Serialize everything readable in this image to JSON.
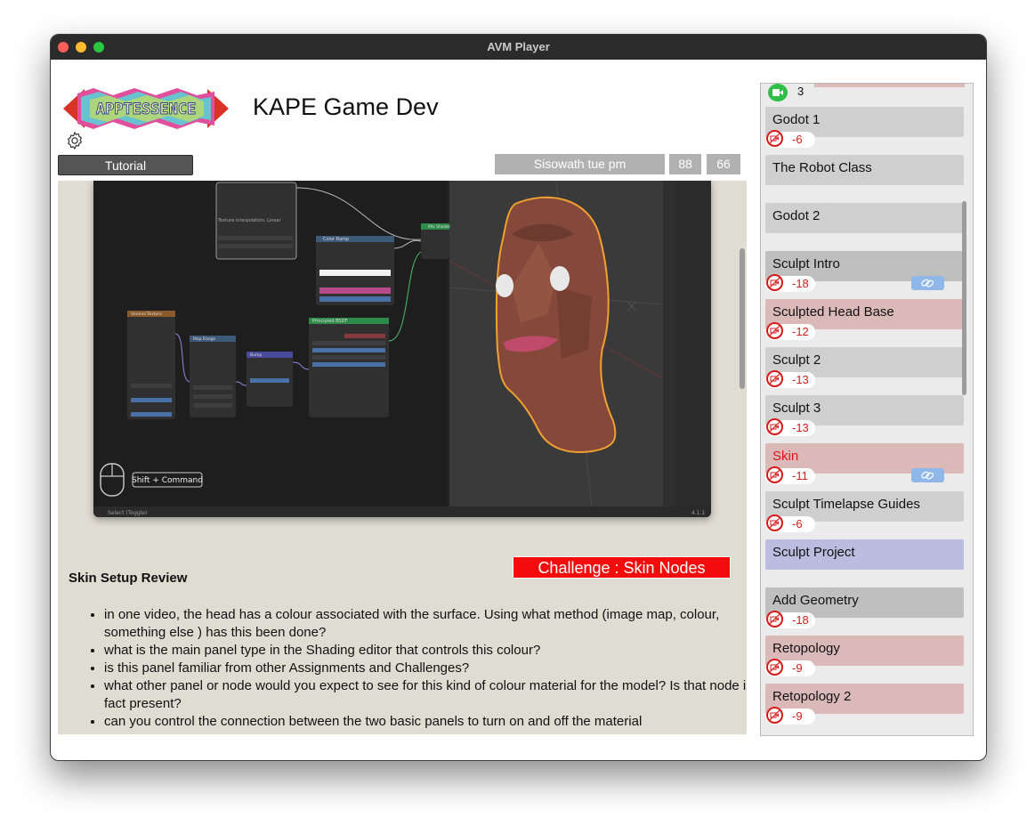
{
  "window": {
    "title": "AVM Player"
  },
  "header": {
    "app_title": "KAPE Game Dev",
    "logo_text": "APPTESSENCE",
    "tutorial_label": "Tutorial",
    "group_label": "Sisowath tue pm",
    "count_a": "88",
    "count_b": "66"
  },
  "video": {
    "shortcut_label": "Shift + Command",
    "status_text": "Select (Toggle)",
    "version": "4.1.1",
    "nodes": {
      "texture": "Texture interpolation: Linear",
      "color_ramp": "Color Ramp",
      "principled": "Principled BSDF",
      "voronoi": "Voronoi Texture",
      "map_range": "Map Range",
      "bump": "Bump",
      "mix_shader": "Mix Shader"
    }
  },
  "challenge": {
    "label": "Challenge : Skin Nodes"
  },
  "section": {
    "title": "Skin Setup Review",
    "questions": [
      "in one video, the head has a colour associated with the surface. Using what method (image map, colour, something else ) has this been done?",
      "what is the main panel type in the Shading editor that controls this colour?",
      "is this panel familiar from other Assignments and Challenges?",
      "what other panel or node would you expect to see for this kind of colour material for the model? Is that node in fact present?",
      "can you control the connection between the two basic panels to turn on and off the material"
    ]
  },
  "sidebar": {
    "top_count": "3",
    "items": [
      {
        "label": "Godot 1",
        "count": "-6"
      },
      {
        "label": "The Robot Class"
      },
      {
        "label": "Godot 2"
      },
      {
        "label": "Sculpt Intro",
        "count": "-18"
      },
      {
        "label": "Sculpted Head Base",
        "count": "-12"
      },
      {
        "label": "Sculpt 2",
        "count": "-13"
      },
      {
        "label": "Sculpt 3",
        "count": "-13"
      },
      {
        "label": "Skin",
        "count": "-11"
      },
      {
        "label": "Sculpt Timelapse Guides",
        "count": "-6"
      },
      {
        "label": "Sculpt Project"
      },
      {
        "label": "Add Geometry",
        "count": "-18"
      },
      {
        "label": "Retopology",
        "count": "-9"
      },
      {
        "label": "Retopology 2",
        "count": "-9"
      }
    ]
  },
  "colors": {
    "item_gray": "#cfcfcf",
    "item_pink": "#dbb9b9",
    "item_blue": "#bcbce0",
    "challenge_red": "#f20c0c",
    "badge_red": "#d61a1a"
  }
}
